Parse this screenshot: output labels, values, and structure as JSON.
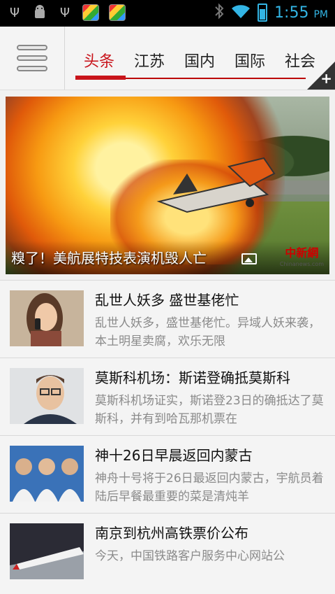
{
  "status_bar": {
    "time": "1:55",
    "ampm": "PM",
    "left_icons": [
      "usb-icon",
      "android-debug-icon",
      "usb-icon",
      "app-notification-icon",
      "app-notification-icon"
    ],
    "right_icons": [
      "bluetooth-icon",
      "wifi-icon",
      "battery-charging-icon"
    ],
    "accent_color": "#33b5e5"
  },
  "header": {
    "tabs": [
      {
        "label": "头条",
        "active": true
      },
      {
        "label": "江苏",
        "active": false
      },
      {
        "label": "国内",
        "active": false
      },
      {
        "label": "国际",
        "active": false
      },
      {
        "label": "社会",
        "active": false
      }
    ],
    "accent_color": "#c8141b"
  },
  "hero": {
    "title": "糗了！美航展特技表演机毁人亡",
    "watermark": "中新網",
    "watermark_sub": "Chinanews.com"
  },
  "news": [
    {
      "title": "乱世人妖多 盛世基佬忙",
      "summary": "乱世人妖多，盛世基佬忙。异域人妖来袭，本土明星卖腐，欢乐无限"
    },
    {
      "title": "莫斯科机场：斯诺登确抵莫斯科",
      "summary": "莫斯科机场证实，斯诺登23日的确抵达了莫斯科，并有到哈瓦那机票在"
    },
    {
      "title": "神十26日早晨返回内蒙古",
      "summary": "神舟十号将于26日最返回内蒙古，宇航员着陆后早餐最重要的菜是清炖羊"
    },
    {
      "title": "南京到杭州高铁票价公布",
      "summary": "今天，中国铁路客户服务中心网站公"
    }
  ]
}
